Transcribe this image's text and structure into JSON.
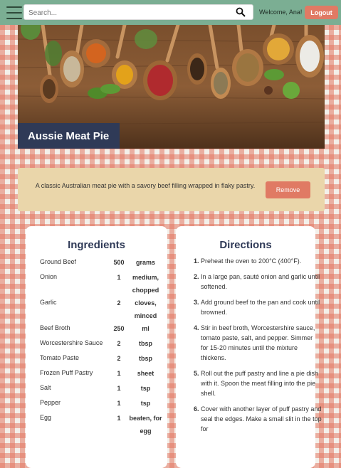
{
  "header": {
    "search_placeholder": "Search...",
    "welcome": "Welcome, Ana!",
    "logout_label": "Logout"
  },
  "recipe": {
    "title": "Aussie Meat Pie",
    "description": "A classic Australian meat pie with a savory beef filling wrapped in flaky pastry.",
    "remove_label": "Remove"
  },
  "ingredients": {
    "heading": "Ingredients",
    "items": [
      {
        "name": "Ground Beef",
        "qty": "500",
        "unit": "grams"
      },
      {
        "name": "Onion",
        "qty": "1",
        "unit": "medium, chopped"
      },
      {
        "name": "Garlic",
        "qty": "2",
        "unit": "cloves, minced"
      },
      {
        "name": "Beef Broth",
        "qty": "250",
        "unit": "ml"
      },
      {
        "name": "Worcestershire Sauce",
        "qty": "2",
        "unit": "tbsp"
      },
      {
        "name": "Tomato Paste",
        "qty": "2",
        "unit": "tbsp"
      },
      {
        "name": "Frozen Puff Pastry",
        "qty": "1",
        "unit": "sheet"
      },
      {
        "name": "Salt",
        "qty": "1",
        "unit": "tsp"
      },
      {
        "name": "Pepper",
        "qty": "1",
        "unit": "tsp"
      },
      {
        "name": "Egg",
        "qty": "1",
        "unit": "beaten, for egg"
      }
    ]
  },
  "directions": {
    "heading": "Directions",
    "steps": [
      "Preheat the oven to 200°C (400°F).",
      "In a large pan, sauté onion and garlic until softened.",
      "Add ground beef to the pan and cook until browned.",
      "Stir in beef broth, Worcestershire sauce, tomato paste, salt, and pepper. Simmer for 15-20 minutes until the mixture thickens.",
      "Roll out the puff pastry and line a pie dish with it. Spoon the meat filling into the pie shell.",
      "Cover with another layer of puff pastry and seal the edges. Make a small slit in the top for"
    ]
  },
  "icons": {
    "menu": "hamburger-menu-icon",
    "search": "search-icon"
  },
  "colors": {
    "header_bg": "#7bae93",
    "accent": "#e07a64",
    "title_bg": "#2f3a57",
    "desc_bg": "#ead6aa"
  }
}
